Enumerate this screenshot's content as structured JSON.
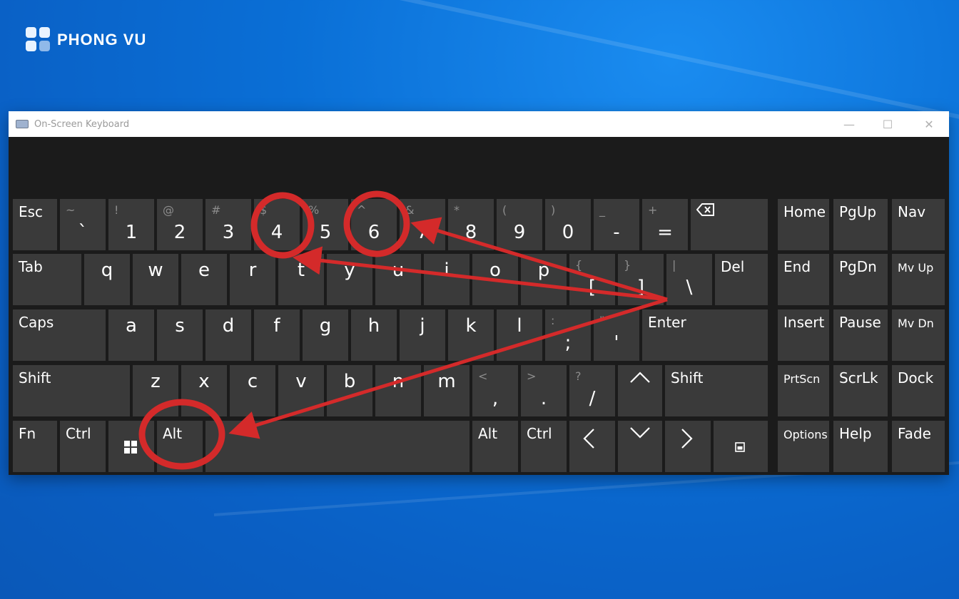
{
  "brand": {
    "name": "PHONG VU"
  },
  "window": {
    "title": "On-Screen Keyboard",
    "minimize": "—",
    "maximize": "☐",
    "close": "✕"
  },
  "keys": {
    "esc": "Esc",
    "tilde": "~",
    "backtick": "`",
    "excl": "!",
    "one": "1",
    "at": "@",
    "two": "2",
    "hash": "#",
    "three": "3",
    "dollar": "$",
    "four": "4",
    "percent": "%",
    "five": "5",
    "caret": "^",
    "six": "6",
    "amp": "&",
    "seven": "7",
    "star": "*",
    "eight": "8",
    "lparen": "(",
    "nine": "9",
    "rparen": ")",
    "zero": "0",
    "underscore": "_",
    "minus": "-",
    "plus": "+",
    "equals": "=",
    "tab": "Tab",
    "q": "q",
    "w": "w",
    "e": "e",
    "r": "r",
    "t": "t",
    "y": "y",
    "u": "u",
    "i": "i",
    "o": "o",
    "p": "p",
    "lbrace": "{",
    "lbracket": "[",
    "rbrace": "}",
    "rbracket": "]",
    "pipe": "|",
    "backslash": "\\",
    "del": "Del",
    "caps": "Caps",
    "a": "a",
    "s": "s",
    "d": "d",
    "f": "f",
    "g": "g",
    "h": "h",
    "j": "j",
    "k": "k",
    "l": "l",
    "colon": ":",
    "semicolon": ";",
    "quote": "\"",
    "apos": "'",
    "enter": "Enter",
    "shift": "Shift",
    "z": "z",
    "x": "x",
    "c": "c",
    "v": "v",
    "b": "b",
    "n": "n",
    "m": "m",
    "lt": "<",
    "comma": ",",
    "gt": ">",
    "period": ".",
    "question": "?",
    "slash": "/",
    "fn": "Fn",
    "ctrl": "Ctrl",
    "alt": "Alt",
    "home": "Home",
    "pgup": "PgUp",
    "nav": "Nav",
    "end": "End",
    "pgdn": "PgDn",
    "mvup": "Mv Up",
    "insert": "Insert",
    "pause": "Pause",
    "mvdn": "Mv Dn",
    "prtscn": "PrtScn",
    "scrlk": "ScrLk",
    "dock": "Dock",
    "options": "Options",
    "help": "Help",
    "fade": "Fade"
  },
  "annotation": {
    "color": "#d42a2a",
    "circled_keys": [
      "4",
      "6",
      "Alt"
    ]
  }
}
